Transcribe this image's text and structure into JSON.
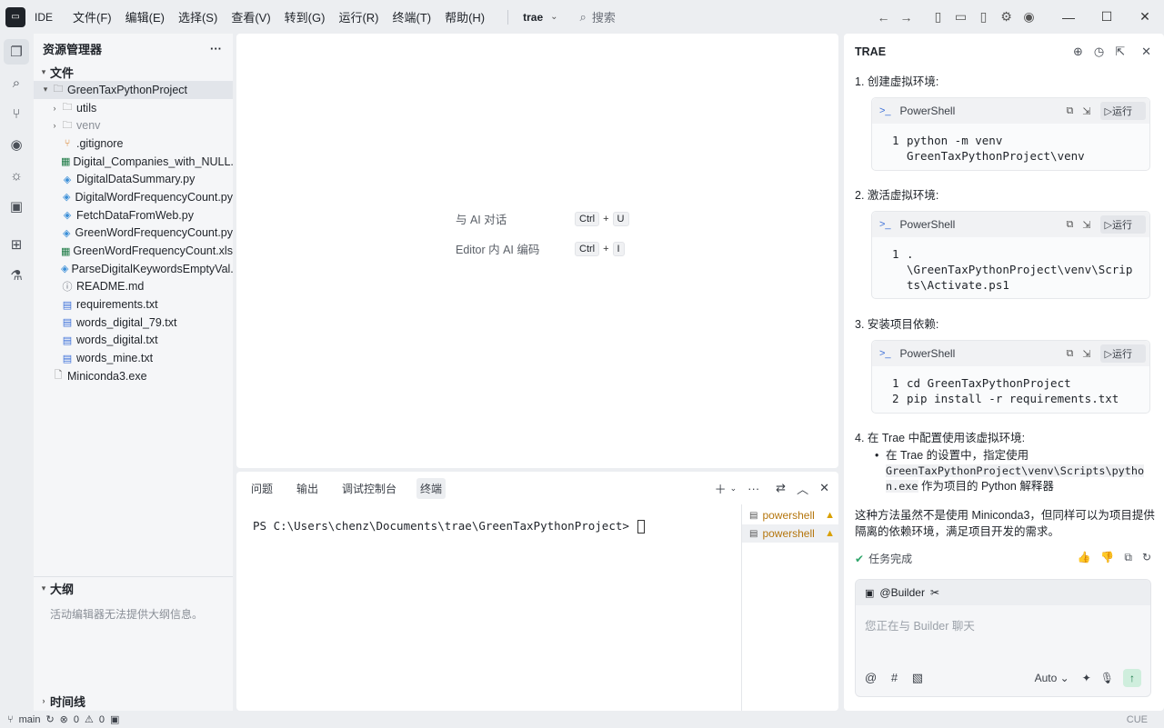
{
  "titlebar": {
    "ide_label": "IDE",
    "menu": [
      "文件(F)",
      "编辑(E)",
      "选择(S)",
      "查看(V)",
      "转到(G)",
      "运行(R)",
      "终端(T)",
      "帮助(H)"
    ],
    "project": "trae",
    "search_placeholder": "搜索"
  },
  "explorer": {
    "title": "资源管理器",
    "files_section": "文件",
    "root_folder": "GreenTaxPythonProject",
    "items": [
      {
        "name": "utils",
        "type": "folder",
        "color": "#1f2329"
      },
      {
        "name": "venv",
        "type": "folder",
        "color": "#8a8f97"
      },
      {
        "name": ".gitignore",
        "type": "git",
        "color": "#1f2329"
      },
      {
        "name": "Digital_Companies_with_NULL...",
        "type": "excel",
        "color": "#1f2329"
      },
      {
        "name": "DigitalDataSummary.py",
        "type": "python",
        "color": "#1f2329"
      },
      {
        "name": "DigitalWordFrequencyCount.py",
        "type": "python",
        "color": "#1f2329"
      },
      {
        "name": "FetchDataFromWeb.py",
        "type": "python",
        "color": "#1f2329"
      },
      {
        "name": "GreenWordFrequencyCount.py",
        "type": "python",
        "color": "#1f2329"
      },
      {
        "name": "GreenWordFrequencyCount.xlsx",
        "type": "excel",
        "color": "#1f2329"
      },
      {
        "name": "ParseDigitalKeywordsEmptyVal...",
        "type": "python",
        "color": "#1f2329"
      },
      {
        "name": "README.md",
        "type": "info",
        "color": "#1f2329"
      },
      {
        "name": "requirements.txt",
        "type": "text",
        "color": "#1f2329"
      },
      {
        "name": "words_digital_79.txt",
        "type": "text",
        "color": "#1f2329"
      },
      {
        "name": "words_digital.txt",
        "type": "text",
        "color": "#1f2329"
      },
      {
        "name": "words_mine.txt",
        "type": "text",
        "color": "#1f2329"
      }
    ],
    "extra_file": "Miniconda3.exe",
    "outline_title": "大纲",
    "outline_msg": "活动编辑器无法提供大纲信息。",
    "timeline_title": "时间线"
  },
  "editor": {
    "hints": [
      {
        "label": "与 AI 对话",
        "key1": "Ctrl",
        "key2": "U"
      },
      {
        "label": "Editor 内 AI 编码",
        "key1": "Ctrl",
        "key2": "I"
      }
    ]
  },
  "panel": {
    "tabs": [
      "问题",
      "输出",
      "调试控制台",
      "终端"
    ],
    "active_tab": "终端",
    "prompt": "PS C:\\Users\\chenz\\Documents\\trae\\GreenTaxPythonProject>",
    "terminals": [
      "powershell",
      "powershell"
    ]
  },
  "chat": {
    "title": "TRAE",
    "steps": [
      "1. 创建虚拟环境:",
      "2. 激活虚拟环境:",
      "3. 安装项目依赖:",
      "4. 在 Trae 中配置使用该虚拟环境:"
    ],
    "shell_label": "PowerShell",
    "run_label": "运行",
    "code_blocks": [
      [
        [
          "1",
          "python -m venv"
        ],
        [
          "",
          "GreenTaxPythonProject\\venv"
        ]
      ],
      [
        [
          "1",
          "."
        ],
        [
          "",
          "\\GreenTaxPythonProject\\venv\\Scrip"
        ],
        [
          "",
          "ts\\Activate.ps1"
        ]
      ],
      [
        [
          "1",
          "cd GreenTaxPythonProject"
        ],
        [
          "2",
          "pip install -r requirements.txt"
        ]
      ]
    ],
    "bullet_pre": "在 Trae 的设置中，指定使用",
    "bullet_code1": "GreenTaxPythonProject\\venv\\Scripts\\pytho",
    "bullet_code2": "n.exe",
    "bullet_post": " 作为项目的 Python 解释器",
    "summary": "这种方法虽然不是使用 Miniconda3，但同样可以为项目提供隔离的依赖环境，满足项目开发的需求。",
    "task_done": "任务完成",
    "agent": "@Builder",
    "input_placeholder": "您正在与 Builder 聊天",
    "mode": "Auto"
  },
  "status": {
    "branch": "main",
    "errors": "0",
    "warnings": "0",
    "right": "CUE"
  }
}
